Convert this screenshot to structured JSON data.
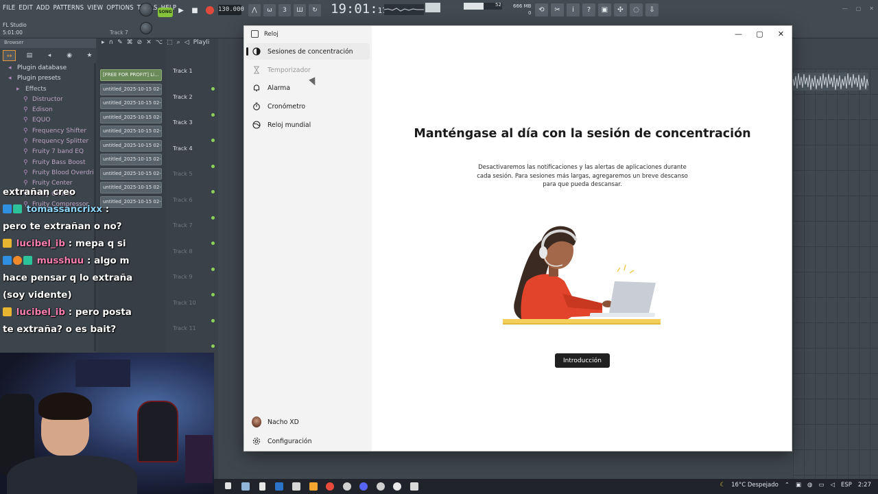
{
  "fl": {
    "menu": [
      "FILE",
      "EDIT",
      "ADD",
      "PATTERNS",
      "VIEW",
      "OPTIONS",
      "TOOLS",
      "HELP"
    ],
    "song_badge": "SONG",
    "tempo": "130.000",
    "clock_main": "19:01",
    "clock_sub": "17",
    "memory": "666 MB",
    "memory_sub": "0",
    "volume_value": "52",
    "status_title": "FL Studio",
    "status_time": "5:01:00",
    "status_track": "Track 7",
    "browser_title": "Browser",
    "playlist_label": "Playli",
    "tree": [
      {
        "label": "Plugin database",
        "level": 0
      },
      {
        "label": "Plugin presets",
        "level": 0
      },
      {
        "label": "Effects",
        "level": 1
      },
      {
        "label": "Distructor",
        "level": 2
      },
      {
        "label": "Edison",
        "level": 2
      },
      {
        "label": "EQUO",
        "level": 2
      },
      {
        "label": "Frequency Shifter",
        "level": 2
      },
      {
        "label": "Frequency Splitter",
        "level": 2
      },
      {
        "label": "Fruity 7 band EQ",
        "level": 2
      },
      {
        "label": "Fruity Bass Boost",
        "level": 2
      },
      {
        "label": "Fruity Blood Overdrive",
        "level": 2
      },
      {
        "label": "Fruity Center",
        "level": 2
      },
      {
        "label": "Fruity Chorus",
        "level": 2
      },
      {
        "label": "Fruity Compressor",
        "level": 2
      }
    ],
    "patterns": [
      "[FREE FOR PROFIT] Li...",
      "untitled_2025-10-15 02-...",
      "untitled_2025-10-15 02-...",
      "untitled_2025-10-15 02-...",
      "untitled_2025-10-15 02-...",
      "untitled_2025-10-15 02-...",
      "untitled_2025-10-15 02-...",
      "untitled_2025-10-15 02-...",
      "untitled_2025-10-15 02-...",
      "untitled_2025-10-15 02-..."
    ],
    "tracks": [
      "Track 1",
      "Track 2",
      "Track 3",
      "Track 4",
      "Track 5",
      "Track 6",
      "Track 7",
      "Track 8",
      "Track 9",
      "Track 10",
      "Track 11"
    ]
  },
  "chat": [
    {
      "user": "",
      "message": "extrañan creo"
    },
    {
      "user": "tomassancrixx",
      "message": "pero te extrañan o no?"
    },
    {
      "user": "lucibel_ib",
      "message": "mepa q si"
    },
    {
      "user": "musshuu",
      "message": "algo m hace pensar q lo extrañan (soy vidente)"
    },
    {
      "user": "lucibel_ib",
      "message": "pero posta te extraña? o es bait?"
    }
  ],
  "clock_app": {
    "app_title": "Reloj",
    "nav": [
      {
        "label": "Sesiones de concentración",
        "icon": "focus-icon",
        "state": "active"
      },
      {
        "label": "Temporizador",
        "icon": "hourglass-icon",
        "state": "disabled"
      },
      {
        "label": "Alarma",
        "icon": "bell-icon",
        "state": "normal"
      },
      {
        "label": "Cronómetro",
        "icon": "stopwatch-icon",
        "state": "normal"
      },
      {
        "label": "Reloj mundial",
        "icon": "globe-icon",
        "state": "normal"
      }
    ],
    "user_name": "Nacho XD",
    "settings_label": "Configuración",
    "headline": "Manténgase al día con la sesión de concentración",
    "description": "Desactivaremos las notificaciones y las alertas de aplicaciones durante cada sesión. Para sesiones más largas, agregaremos un breve descanso para que pueda descansar.",
    "cta_label": "Introducción"
  },
  "taskbar": {
    "weather": "16°C  Despejado",
    "language": "ESP",
    "time": "2:27"
  },
  "colors": {
    "fl_bg": "#434b52",
    "song_green": "#86c33a",
    "record_red": "#e04a3b",
    "illus_orange": "#e1442a",
    "illus_yellow": "#f4d05a",
    "cta_black": "#202020"
  }
}
